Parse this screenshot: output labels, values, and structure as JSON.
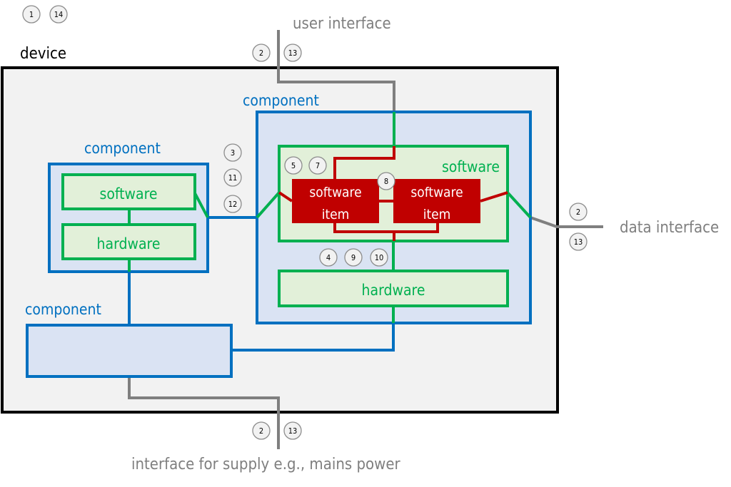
{
  "colors": {
    "device_border": "#000000",
    "device_fill": "#f2f2f2",
    "component_border": "#0070c0",
    "component_fill": "#dae3f3",
    "block_border": "#00b050",
    "block_fill": "#e2f0d9",
    "software_item_fill": "#c00000",
    "interface_line": "#7f7f7f"
  },
  "device": {
    "label": "device"
  },
  "components": {
    "left": {
      "label": "component",
      "software_label": "software",
      "hardware_label": "hardware"
    },
    "right": {
      "label": "component",
      "software_label": "software",
      "hardware_label": "hardware",
      "software_items": [
        {
          "line1": "software",
          "line2": "item"
        },
        {
          "line1": "software",
          "line2": "item"
        }
      ]
    },
    "bottom": {
      "label": "component"
    }
  },
  "interfaces": {
    "user": "user interface",
    "data": "data interface",
    "supply": "interface for supply e.g., mains power"
  },
  "badges": {
    "top_left": [
      "1",
      "14"
    ],
    "user_interface": [
      "2",
      "13"
    ],
    "inter_component": [
      "3",
      "11",
      "12"
    ],
    "software_items": [
      "5",
      "7"
    ],
    "between_items": "8",
    "sw_hw": [
      "4",
      "9",
      "10"
    ],
    "data_interface": [
      "2",
      "13"
    ],
    "supply_interface": [
      "2",
      "13"
    ]
  }
}
